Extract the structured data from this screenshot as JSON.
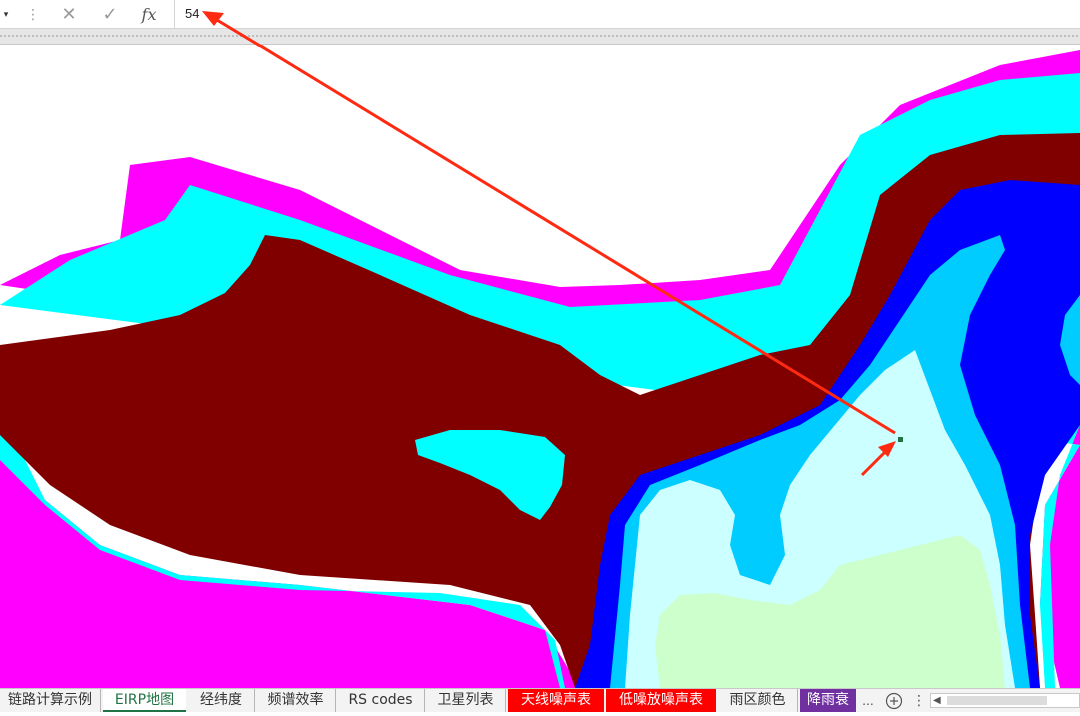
{
  "formula_bar": {
    "value": "54",
    "fx": "fx",
    "cancel_icon": "x-icon",
    "enter_icon": "check-icon"
  },
  "map": {
    "colors": {
      "magenta": "#ff00ff",
      "cyan": "#00ffff",
      "maroon": "#800000",
      "blue": "#0000ff",
      "sky": "#00ccff",
      "pale_cyan": "#ccffff",
      "pale_green": "#ccffcc",
      "selected_cell": "#217346",
      "annotation_arrow": "#ff2a12"
    }
  },
  "sheet_tabs": {
    "items": [
      {
        "label": "链路计算示例"
      },
      {
        "label": "EIRP地图"
      },
      {
        "label": "经纬度"
      },
      {
        "label": "频谱效率"
      },
      {
        "label": "RS codes"
      },
      {
        "label": "卫星列表"
      },
      {
        "label": "天线噪声表"
      },
      {
        "label": "低噪放噪声表"
      },
      {
        "label": "雨区颜色"
      },
      {
        "label": "降雨衰"
      }
    ],
    "more": "...",
    "add_icon": "plus-circle-icon"
  }
}
